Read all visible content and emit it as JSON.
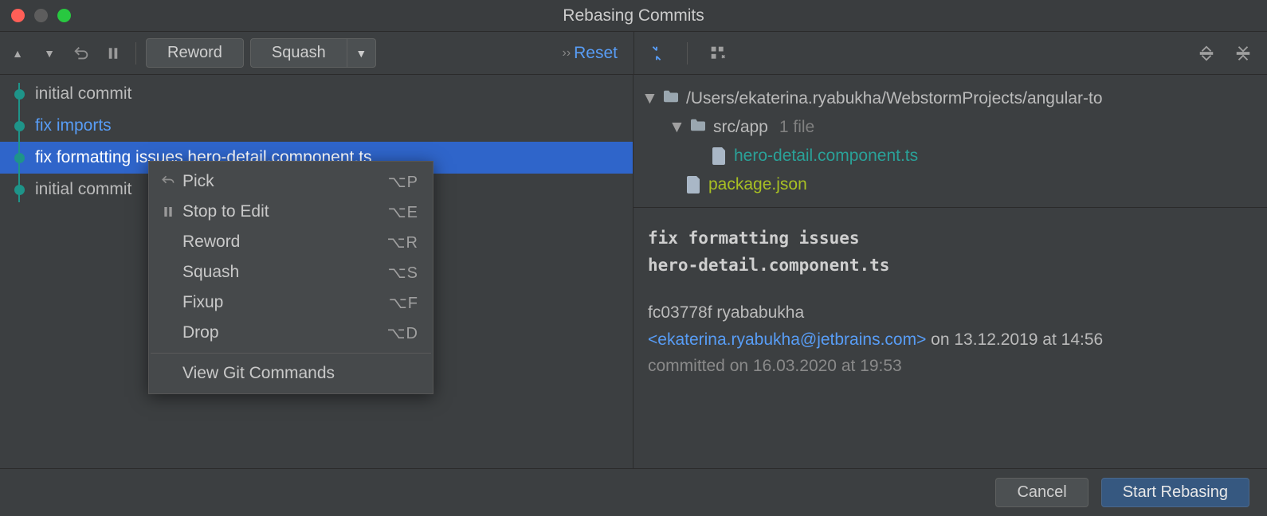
{
  "window": {
    "title": "Rebasing Commits"
  },
  "toolbar": {
    "reword_label": "Reword",
    "squash_label": "Squash",
    "reset_label": "Reset"
  },
  "commits": [
    {
      "message": "initial commit"
    },
    {
      "message": "fix imports"
    },
    {
      "message": "fix formatting issues hero-detail.component.ts"
    },
    {
      "message": "initial commit"
    }
  ],
  "context_menu": {
    "items": [
      {
        "icon": "undo",
        "label": "Pick",
        "shortcut": "⌥P"
      },
      {
        "icon": "pause",
        "label": "Stop to Edit",
        "shortcut": "⌥E"
      },
      {
        "icon": "",
        "label": "Reword",
        "shortcut": "⌥R"
      },
      {
        "icon": "",
        "label": "Squash",
        "shortcut": "⌥S"
      },
      {
        "icon": "",
        "label": "Fixup",
        "shortcut": "⌥F"
      },
      {
        "icon": "",
        "label": "Drop",
        "shortcut": "⌥D"
      }
    ],
    "footer_label": "View Git Commands"
  },
  "tree": {
    "root_path": "/Users/ekaterina.ryabukha/WebstormProjects/angular-to",
    "folder": {
      "name": "src/app",
      "badge": "1 file"
    },
    "files": [
      {
        "name": "hero-detail.component.ts",
        "color": "teal",
        "icon": "ts"
      },
      {
        "name": "package.json",
        "color": "green",
        "icon": "json"
      }
    ]
  },
  "details": {
    "title_line1": "fix formatting issues",
    "title_line2": "hero-detail.component.ts",
    "hash_author": "fc03778f ryababukha",
    "email": "<ekaterina.ryabukha@jetbrains.com>",
    "date_tail": " on 13.12.2019 at 14:56",
    "committed": "committed on 16.03.2020 at 19:53"
  },
  "footer": {
    "cancel_label": "Cancel",
    "start_label": "Start Rebasing"
  }
}
